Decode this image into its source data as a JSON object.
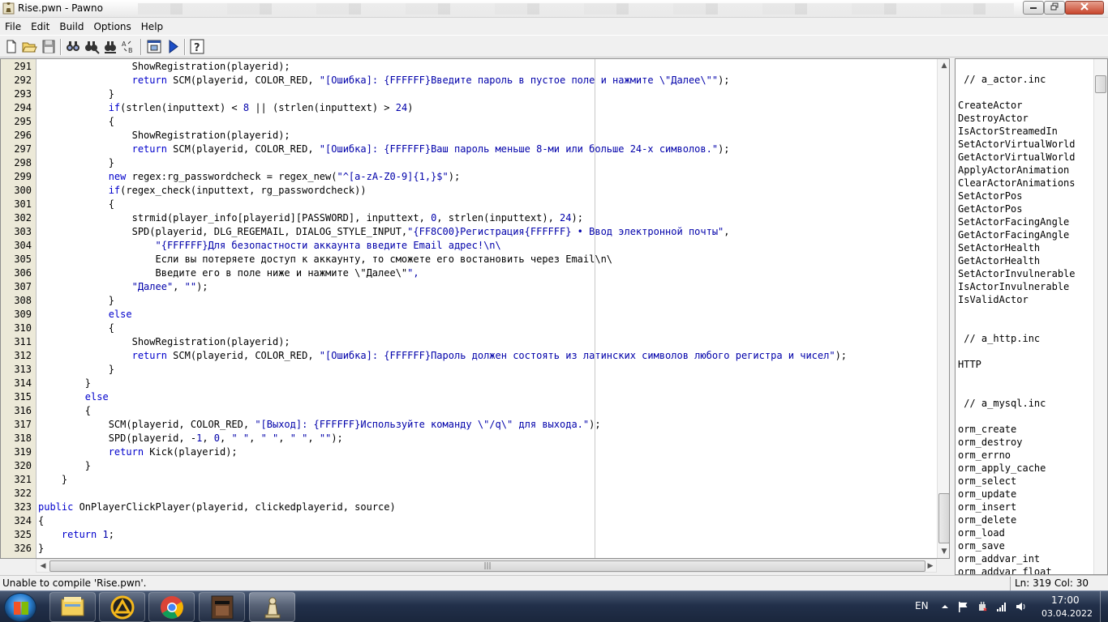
{
  "window": {
    "title": "Rise.pwn - Pawno"
  },
  "menu": [
    "File",
    "Edit",
    "Build",
    "Options",
    "Help"
  ],
  "toolbar": {
    "buttons": [
      "new-file-icon",
      "open-folder-icon",
      "save-icon",
      "find-icon",
      "find-next-icon",
      "replace-icon",
      "goto-line-icon",
      "compile-icon",
      "run-icon",
      "help-icon"
    ]
  },
  "editor": {
    "lines": [
      {
        "n": "291",
        "t": "                ShowRegistration(playerid);"
      },
      {
        "n": "292",
        "t": "                return SCM(playerid, COLOR_RED, \"[Ошибка]: {FFFFFF}Введите пароль в пустое поле и нажмите \\\"Далее\\\"\");"
      },
      {
        "n": "293",
        "t": "            }"
      },
      {
        "n": "294",
        "t": "            if(strlen(inputtext) < 8 || (strlen(inputtext) > 24)"
      },
      {
        "n": "295",
        "t": "            {"
      },
      {
        "n": "296",
        "t": "                ShowRegistration(playerid);"
      },
      {
        "n": "297",
        "t": "                return SCM(playerid, COLOR_RED, \"[Ошибка]: {FFFFFF}Ваш пароль меньше 8-ми или больше 24-х символов.\");"
      },
      {
        "n": "298",
        "t": "            }"
      },
      {
        "n": "299",
        "t": "            new regex:rg_passwordcheck = regex_new(\"^[a-zA-Z0-9]{1,}$\");"
      },
      {
        "n": "300",
        "t": "            if(regex_check(inputtext, rg_passwordcheck))"
      },
      {
        "n": "301",
        "t": "            {"
      },
      {
        "n": "302",
        "t": "                strmid(player_info[playerid][PASSWORD], inputtext, 0, strlen(inputtext), 24);"
      },
      {
        "n": "303",
        "t": "                SPD(playerid, DLG_REGEMAIL, DIALOG_STYLE_INPUT,\"{FF8C00}Регистрация{FFFFFF} • Ввод электронной почты\","
      },
      {
        "n": "304",
        "t": "                    \"{FFFFFF}Для безопастности аккаунта введите Email адрес!\\n\\"
      },
      {
        "n": "305",
        "t": "                    Если вы потеряете доступ к аккаунту, то сможете его востановить через Email\\n\\"
      },
      {
        "n": "306",
        "t": "                    Введите его в поле ниже и нажмите \\\"Далее\\\"\","
      },
      {
        "n": "307",
        "t": "                \"Далее\", \"\");"
      },
      {
        "n": "308",
        "t": "            }"
      },
      {
        "n": "309",
        "t": "            else"
      },
      {
        "n": "310",
        "t": "            {"
      },
      {
        "n": "311",
        "t": "                ShowRegistration(playerid);"
      },
      {
        "n": "312",
        "t": "                return SCM(playerid, COLOR_RED, \"[Ошибка]: {FFFFFF}Пароль должен состоять из латинских символов любого регистра и чисел\");"
      },
      {
        "n": "313",
        "t": "            }"
      },
      {
        "n": "314",
        "t": "        }"
      },
      {
        "n": "315",
        "t": "        else"
      },
      {
        "n": "316",
        "t": "        {"
      },
      {
        "n": "317",
        "t": "            SCM(playerid, COLOR_RED, \"[Выход]: {FFFFFF}Используйте команду \\\"/q\\\" для выхода.\");"
      },
      {
        "n": "318",
        "t": "            SPD(playerid, -1, 0, \" \", \" \", \" \", \"\");"
      },
      {
        "n": "319",
        "t": "            return Kick(playerid);"
      },
      {
        "n": "320",
        "t": "        }"
      },
      {
        "n": "321",
        "t": "    }"
      },
      {
        "n": "322",
        "t": ""
      },
      {
        "n": "323",
        "t": "public OnPlayerClickPlayer(playerid, clickedplayerid, source)"
      },
      {
        "n": "324",
        "t": "{"
      },
      {
        "n": "325",
        "t": "    return 1;"
      },
      {
        "n": "326",
        "t": "}"
      }
    ]
  },
  "sidepanel": {
    "items": [
      " // a_actor.inc",
      "",
      "CreateActor",
      "DestroyActor",
      "IsActorStreamedIn",
      "SetActorVirtualWorld",
      "GetActorVirtualWorld",
      "ApplyActorAnimation",
      "ClearActorAnimations",
      "SetActorPos",
      "GetActorPos",
      "SetActorFacingAngle",
      "GetActorFacingAngle",
      "SetActorHealth",
      "GetActorHealth",
      "SetActorInvulnerable",
      "IsActorInvulnerable",
      "IsValidActor",
      "",
      "",
      " // a_http.inc",
      "",
      "HTTP",
      "",
      "",
      " // a_mysql.inc",
      "",
      "orm_create",
      "orm_destroy",
      "orm_errno",
      "orm_apply_cache",
      "orm_select",
      "orm_update",
      "orm_insert",
      "orm_delete",
      "orm_load",
      "orm_save",
      "orm_addvar_int",
      "orm_addvar_float"
    ]
  },
  "status": {
    "message": "Unable to compile 'Rise.pwn'.",
    "position": "Ln: 319   Col: 30"
  },
  "taskbar": {
    "apps": [
      "explorer-icon",
      "archicad-icon",
      "chrome-icon",
      "gta-sa-icon",
      "pawno-icon"
    ],
    "language": "EN",
    "time": "17:00",
    "date": "03.04.2022"
  }
}
